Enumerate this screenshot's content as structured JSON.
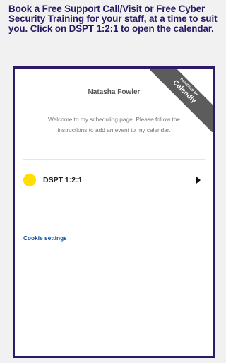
{
  "heading": "Book a Free Support Call/Visit or Free Cyber Security Training for your staff, at a time to suit you.  Click on DSPT 1:2:1 to open the calendar.",
  "widget": {
    "badge": {
      "powered_by": "POWERED BY",
      "brand": "Calendly"
    },
    "owner_name": "Natasha Fowler",
    "welcome_text": "Welcome to my scheduling page. Please follow the instructions to add an event to my calendar.",
    "events": [
      {
        "name": "DSPT 1:2:1",
        "color": "#ffde00"
      }
    ],
    "cookie_settings": "Cookie settings"
  },
  "colors": {
    "heading": "#2a1a63",
    "frame_border": "#2d1b68",
    "badge_bg": "#5c5c5c",
    "link": "#0a4a9e"
  }
}
